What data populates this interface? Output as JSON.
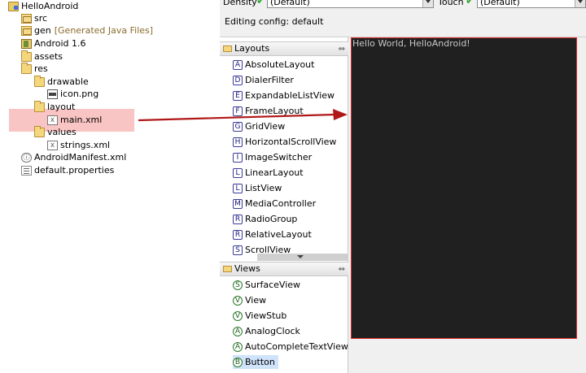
{
  "tree": {
    "items": [
      {
        "label": "HelloAndroid",
        "icon": "project-icon"
      },
      {
        "label": "src",
        "icon": "source-folder-icon"
      },
      {
        "label": "gen",
        "decoration": "[Generated Java Files]",
        "icon": "source-folder-icon"
      },
      {
        "label": "Android 1.6",
        "icon": "library-icon"
      },
      {
        "label": "assets",
        "icon": "folder-icon"
      },
      {
        "label": "res",
        "icon": "folder-icon"
      },
      {
        "label": "drawable",
        "icon": "folder-icon"
      },
      {
        "label": "icon.png",
        "icon": "image-file-icon"
      },
      {
        "label": "layout",
        "icon": "folder-icon"
      },
      {
        "label": "main.xml",
        "icon": "xml-file-icon"
      },
      {
        "label": "values",
        "icon": "folder-icon"
      },
      {
        "label": "strings.xml",
        "icon": "xml-file-icon"
      },
      {
        "label": "AndroidManifest.xml",
        "icon": "manifest-file-icon"
      },
      {
        "label": "default.properties",
        "icon": "properties-file-icon"
      }
    ]
  },
  "config": {
    "density_label": "Density",
    "density_value": "(Default)",
    "touch_label": "Touch",
    "touch_value": "(Default)",
    "editing_config": "Editing config: default"
  },
  "palette": {
    "layouts_header": "Layouts",
    "layouts": [
      {
        "badge": "A",
        "label": "AbsoluteLayout"
      },
      {
        "badge": "D",
        "label": "DialerFilter"
      },
      {
        "badge": "E",
        "label": "ExpandableListView"
      },
      {
        "badge": "F",
        "label": "FrameLayout"
      },
      {
        "badge": "G",
        "label": "GridView"
      },
      {
        "badge": "H",
        "label": "HorizontalScrollView"
      },
      {
        "badge": "I",
        "label": "ImageSwitcher"
      },
      {
        "badge": "L",
        "label": "LinearLayout"
      },
      {
        "badge": "L",
        "label": "ListView"
      },
      {
        "badge": "M",
        "label": "MediaController"
      },
      {
        "badge": "R",
        "label": "RadioGroup"
      },
      {
        "badge": "R",
        "label": "RelativeLayout"
      },
      {
        "badge": "S",
        "label": "ScrollView"
      }
    ],
    "views_header": "Views",
    "views": [
      {
        "badge": "S",
        "label": "SurfaceView"
      },
      {
        "badge": "V",
        "label": "View"
      },
      {
        "badge": "V",
        "label": "ViewStub"
      },
      {
        "badge": "A",
        "label": "AnalogClock"
      },
      {
        "badge": "A",
        "label": "AutoCompleteTextView"
      },
      {
        "badge": "B",
        "label": "Button"
      }
    ]
  },
  "canvas": {
    "hello_text": "Hello World, HelloAndroid!"
  },
  "colors": {
    "highlight": "#f9c4c4",
    "arrow": "#b01818",
    "screen_border": "#e03030",
    "screen_background": "#202020"
  }
}
